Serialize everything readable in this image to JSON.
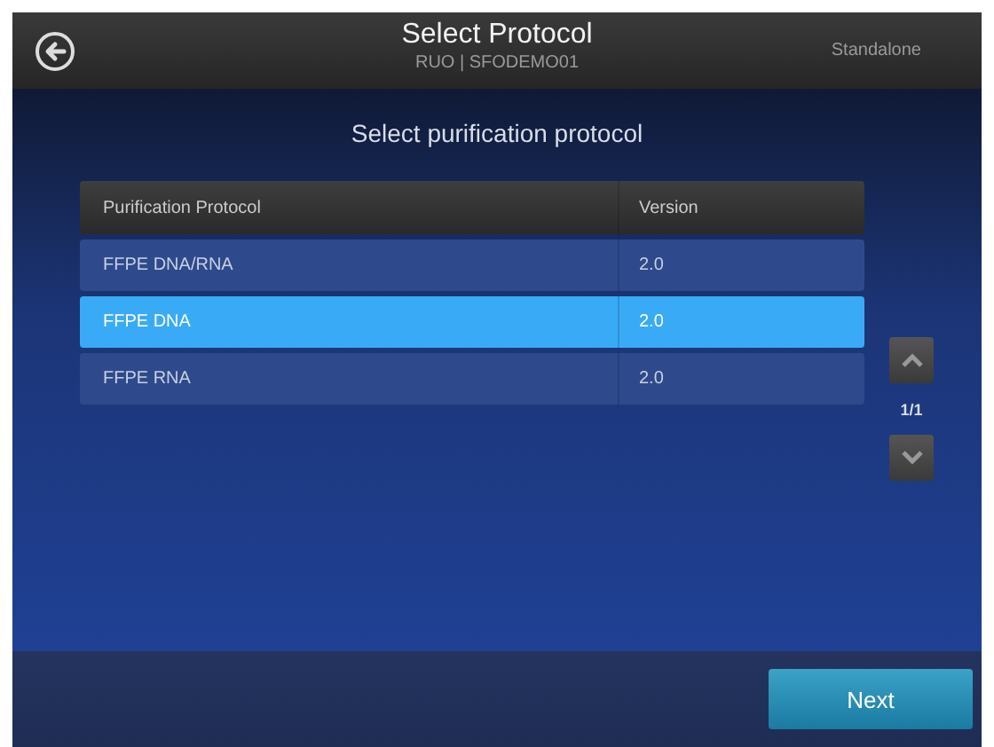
{
  "header": {
    "title": "Select Protocol",
    "subtitle": "RUO | SFODEMO01",
    "mode": "Standalone"
  },
  "prompt": "Select purification protocol",
  "table": {
    "columns": [
      "Purification Protocol",
      "Version"
    ],
    "rows": [
      {
        "cells": [
          "FFPE DNA/RNA",
          "2.0"
        ],
        "selected": false
      },
      {
        "cells": [
          "FFPE DNA",
          "2.0"
        ],
        "selected": true
      },
      {
        "cells": [
          "FFPE RNA",
          "2.0"
        ],
        "selected": false
      }
    ]
  },
  "pager": "1/1",
  "buttons": [
    "Next"
  ]
}
